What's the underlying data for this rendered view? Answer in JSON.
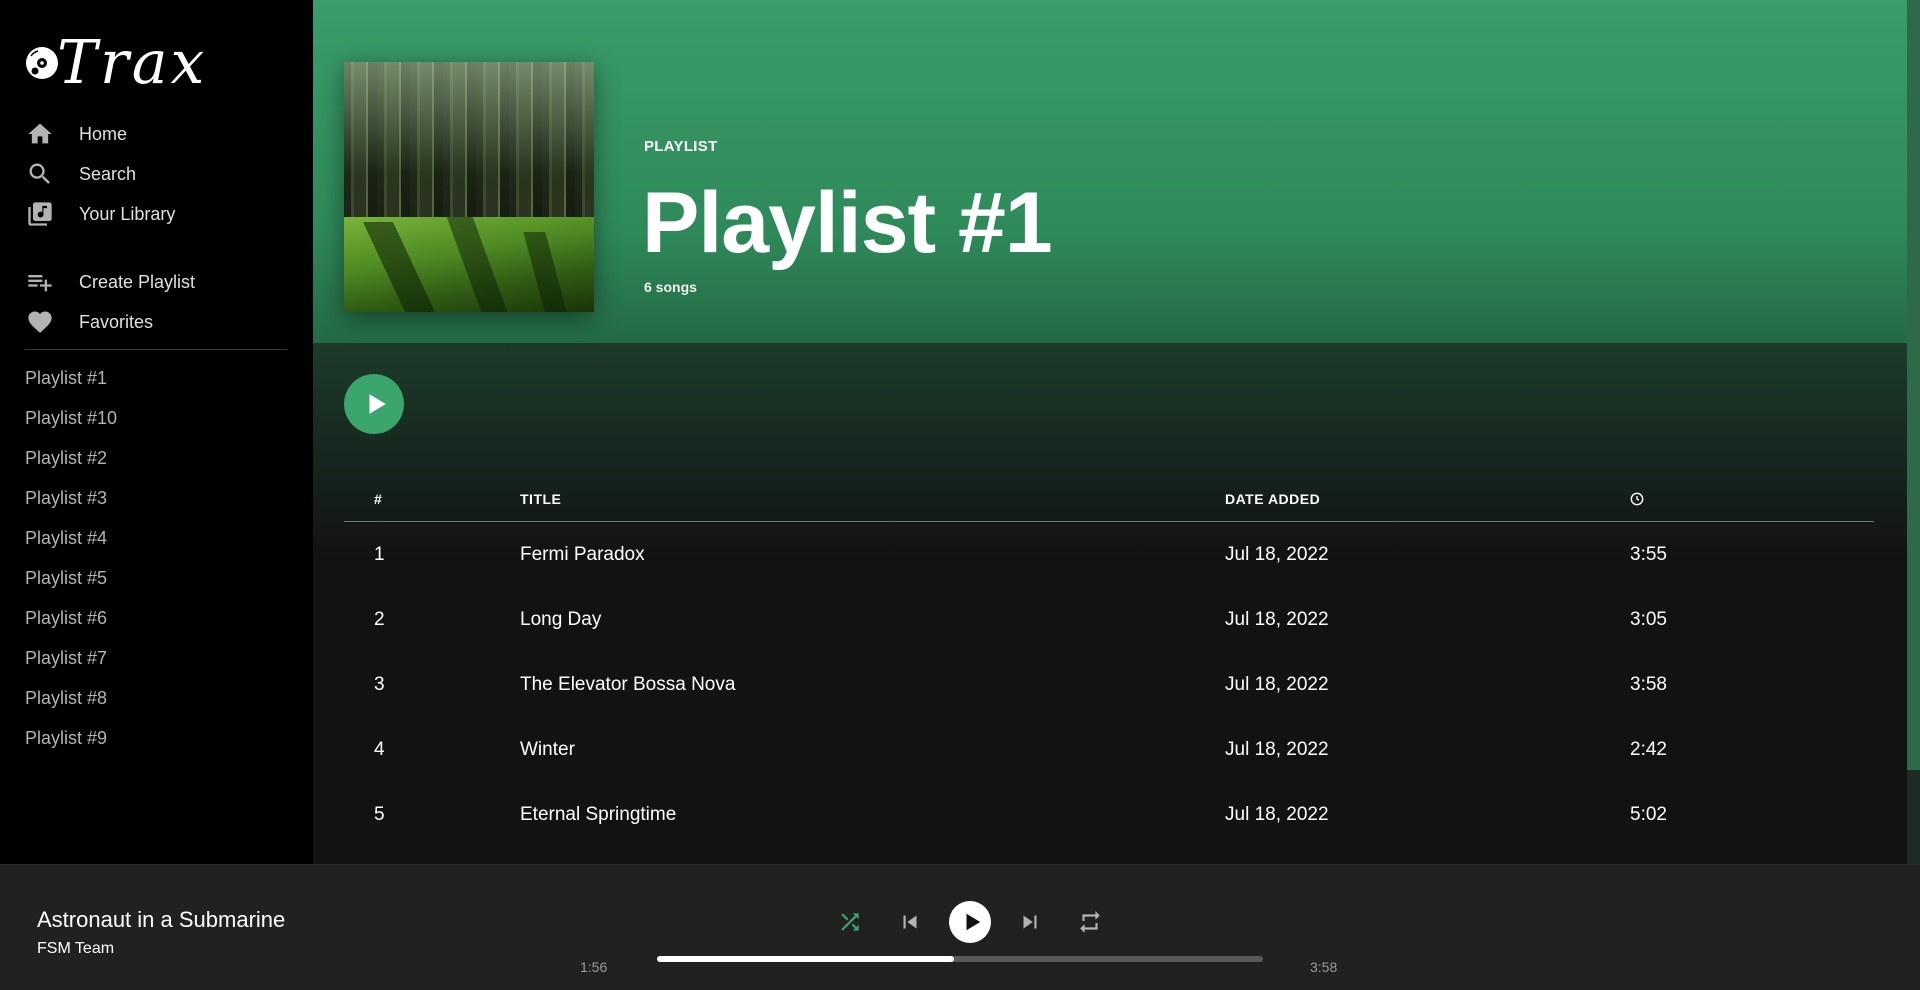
{
  "app": {
    "name": "Trax"
  },
  "sidebar": {
    "nav": [
      {
        "label": "Home",
        "icon": "home-icon"
      },
      {
        "label": "Search",
        "icon": "search-icon"
      },
      {
        "label": "Your Library",
        "icon": "library-icon"
      }
    ],
    "actions": [
      {
        "label": "Create Playlist",
        "icon": "playlist-add-icon"
      },
      {
        "label": "Favorites",
        "icon": "heart-icon"
      }
    ],
    "playlists": [
      "Playlist #1",
      "Playlist #10",
      "Playlist #2",
      "Playlist #3",
      "Playlist #4",
      "Playlist #5",
      "Playlist #6",
      "Playlist #7",
      "Playlist #8",
      "Playlist #9"
    ]
  },
  "header": {
    "type": "PLAYLIST",
    "title": "Playlist #1",
    "subtitle": "6 songs"
  },
  "table": {
    "columns": {
      "num": "#",
      "title": "TITLE",
      "date": "DATE ADDED",
      "duration_icon": "clock-icon"
    },
    "rows": [
      {
        "num": "1",
        "title": "Fermi Paradox",
        "date": "Jul 18, 2022",
        "duration": "3:55"
      },
      {
        "num": "2",
        "title": "Long Day",
        "date": "Jul 18, 2022",
        "duration": "3:05"
      },
      {
        "num": "3",
        "title": "The Elevator Bossa Nova",
        "date": "Jul 18, 2022",
        "duration": "3:58"
      },
      {
        "num": "4",
        "title": "Winter",
        "date": "Jul 18, 2022",
        "duration": "2:42"
      },
      {
        "num": "5",
        "title": "Eternal Springtime",
        "date": "Jul 18, 2022",
        "duration": "5:02"
      }
    ]
  },
  "player": {
    "track": "Astronaut in a Submarine",
    "artist": "FSM Team",
    "current_time": "1:56",
    "total_time": "3:58",
    "progress": 0.49,
    "shuffle_active": true
  },
  "colors": {
    "accent": "#3aa56c",
    "header_top": "#3a9d6a",
    "background": "#121212",
    "sidebar": "#000000",
    "player_bar": "#212121"
  }
}
